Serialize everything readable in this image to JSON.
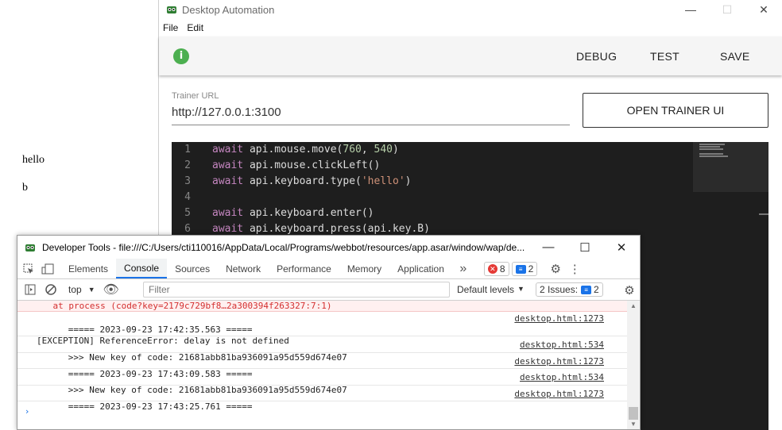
{
  "background": {
    "text1": "hello",
    "text2": "b"
  },
  "automation": {
    "title": "Desktop Automation",
    "menu": [
      "File",
      "Edit"
    ],
    "toolbar": {
      "debug": "DEBUG",
      "test": "TEST",
      "save": "SAVE"
    },
    "trainer_url_label": "Trainer URL",
    "trainer_url": "http://127.0.0.1:3100",
    "open_trainer": "OPEN TRAINER UI",
    "code_lines": [
      {
        "n": "1",
        "kw": "await",
        "expr": " api.mouse.move(",
        "a1": "760",
        "mid": ", ",
        "a2": "540",
        "end": ")"
      },
      {
        "n": "2",
        "kw": "await",
        "expr": " api.mouse.clickLeft()",
        "a1": "",
        "mid": "",
        "a2": "",
        "end": ""
      },
      {
        "n": "3",
        "kw": "await",
        "expr": " api.keyboard.type(",
        "str": "'hello'",
        "end": ")"
      },
      {
        "n": "4"
      },
      {
        "n": "5",
        "kw": "await",
        "expr": " api.keyboard.enter()"
      },
      {
        "n": "6",
        "kw": "await",
        "expr": " api.keyboard.press(api.key.B)"
      }
    ]
  },
  "devtools": {
    "title": "Developer Tools - file:///C:/Users/cti110016/AppData/Local/Programs/webbot/resources/app.asar/window/wap/de...",
    "tabs": [
      "Elements",
      "Console",
      "Sources",
      "Network",
      "Performance",
      "Memory",
      "Application"
    ],
    "error_count": "8",
    "message_count": "2",
    "context": "top",
    "filter_placeholder": "Filter",
    "levels": "Default levels",
    "issues_label": "2 Issues:",
    "issues_count": "2",
    "console_rows": [
      {
        "text": "    at process (code?key=2179c729bf8…2a300394f263327:7:1)",
        "src": "",
        "type": "err"
      },
      {
        "text": "===== 2023-09-23 17:42:35.563 =====\n[EXCEPTION] ReferenceError: delay is not defined",
        "src": "desktop.html:1273",
        "type": "log"
      },
      {
        "text": ">>> New key of code: 21681abb81ba936091a95d559d674e07",
        "src": "desktop.html:534",
        "type": "log"
      },
      {
        "text": "===== 2023-09-23 17:43:09.583 =====",
        "src": "desktop.html:1273",
        "type": "log"
      },
      {
        "text": ">>> New key of code: 21681abb81ba936091a95d559d674e07",
        "src": "desktop.html:534",
        "type": "log"
      },
      {
        "text": "===== 2023-09-23 17:43:25.761 =====",
        "src": "desktop.html:1273",
        "type": "log"
      }
    ],
    "prompt": "›"
  }
}
